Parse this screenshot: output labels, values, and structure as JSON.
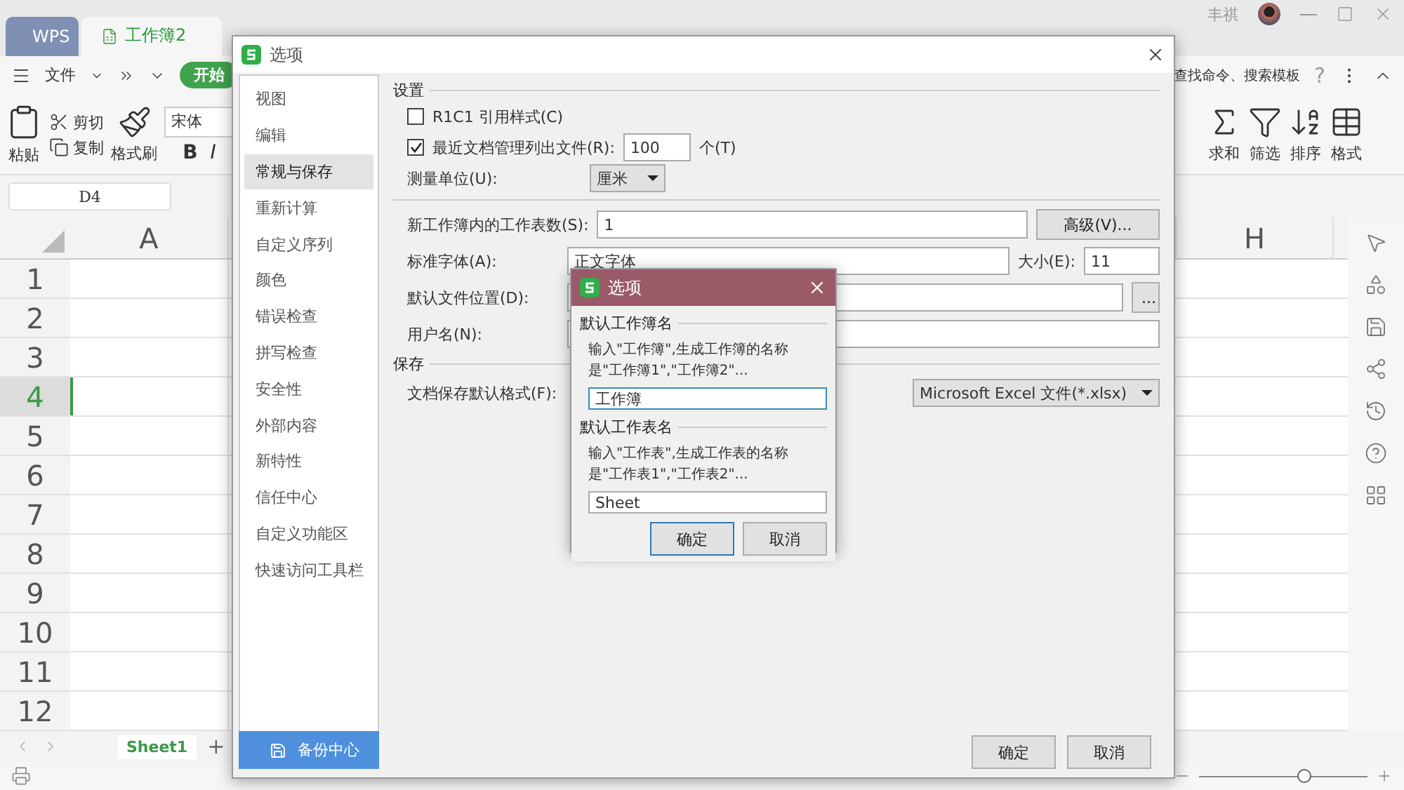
{
  "app": {
    "tabs": [
      {
        "label": "WPS",
        "selected": false
      },
      {
        "label": "工作簿2",
        "selected": true
      }
    ],
    "user": "丰祺",
    "menu": {
      "file": "文件",
      "start": "开始",
      "search": "查找命令、搜索模板",
      "help": "?"
    },
    "toolbar": {
      "paste": "粘贴",
      "cut": "剪切",
      "copy": "复制",
      "format_painter": "格式刷",
      "font": "宋体",
      "bold": "B",
      "italic": "I",
      "right_tools": [
        "求和",
        "筛选",
        "排序",
        "格式"
      ]
    },
    "name_box": "D4",
    "sheet": {
      "columns": [
        "A",
        "H"
      ],
      "rows": [
        {
          "label": "1",
          "selected": false
        },
        {
          "label": "2",
          "selected": false
        },
        {
          "label": "3",
          "selected": false
        },
        {
          "label": "4",
          "selected": true
        },
        {
          "label": "5",
          "selected": false
        },
        {
          "label": "6",
          "selected": false
        },
        {
          "label": "7",
          "selected": false
        },
        {
          "label": "8",
          "selected": false
        },
        {
          "label": "9",
          "selected": false
        },
        {
          "label": "10",
          "selected": false
        },
        {
          "label": "11",
          "selected": false
        },
        {
          "label": "12",
          "selected": false
        }
      ]
    },
    "sheet_tabs": [
      {
        "label": "Sheet1",
        "selected": true
      }
    ],
    "add_sheet": "+"
  },
  "options_dialog": {
    "title": "选项",
    "nav": [
      {
        "label": "视图",
        "selected": false
      },
      {
        "label": "编辑",
        "selected": false
      },
      {
        "label": "常规与保存",
        "selected": true
      },
      {
        "label": "重新计算",
        "selected": false
      },
      {
        "label": "自定义序列",
        "selected": false
      },
      {
        "label": "颜色",
        "selected": false
      },
      {
        "label": "错误检查",
        "selected": false
      },
      {
        "label": "拼写检查",
        "selected": false
      },
      {
        "label": "安全性",
        "selected": false
      },
      {
        "label": "外部内容",
        "selected": false
      },
      {
        "label": "新特性",
        "selected": false
      },
      {
        "label": "信任中心",
        "selected": false
      },
      {
        "label": "自定义功能区",
        "selected": false
      },
      {
        "label": "快速访问工具栏",
        "selected": false
      }
    ],
    "backup": "备份中心",
    "settings_heading": "设置",
    "r1c1": {
      "label": "R1C1 引用样式(C)",
      "checked": false
    },
    "recent": {
      "label": "最近文档管理列出文件(R):",
      "checked": true,
      "value": "100",
      "unit": "个(T)"
    },
    "unit": {
      "label": "测量单位(U):",
      "value": "厘米"
    },
    "sheet_count": {
      "label": "新工作簿内的工作表数(S):",
      "value": "1"
    },
    "advanced": "高级(V)...",
    "font": {
      "label": "标准字体(A):",
      "value": "正文字体"
    },
    "size": {
      "label": "大小(E):",
      "value": "11"
    },
    "location": {
      "label": "默认文件位置(D):"
    },
    "browse": "...",
    "username": {
      "label": "用户名(N):"
    },
    "save_heading": "保存",
    "format": {
      "label": "文档保存默认格式(F):",
      "value": "Microsoft Excel 文件(*.xlsx)"
    },
    "ok": "确定",
    "cancel": "取消"
  },
  "name_dialog": {
    "title": "选项",
    "groups": [
      {
        "heading": "默认工作簿名",
        "hint": "输入\"工作簿\",生成工作簿的名称是\"工作簿1\",\"工作簿2\"...",
        "value": "工作簿",
        "focused": true
      },
      {
        "heading": "默认工作表名",
        "hint": "输入\"工作表\",生成工作表的名称是\"工作表1\",\"工作表2\"...",
        "value": "Sheet",
        "focused": false
      }
    ],
    "ok": "确定",
    "cancel": "取消"
  }
}
